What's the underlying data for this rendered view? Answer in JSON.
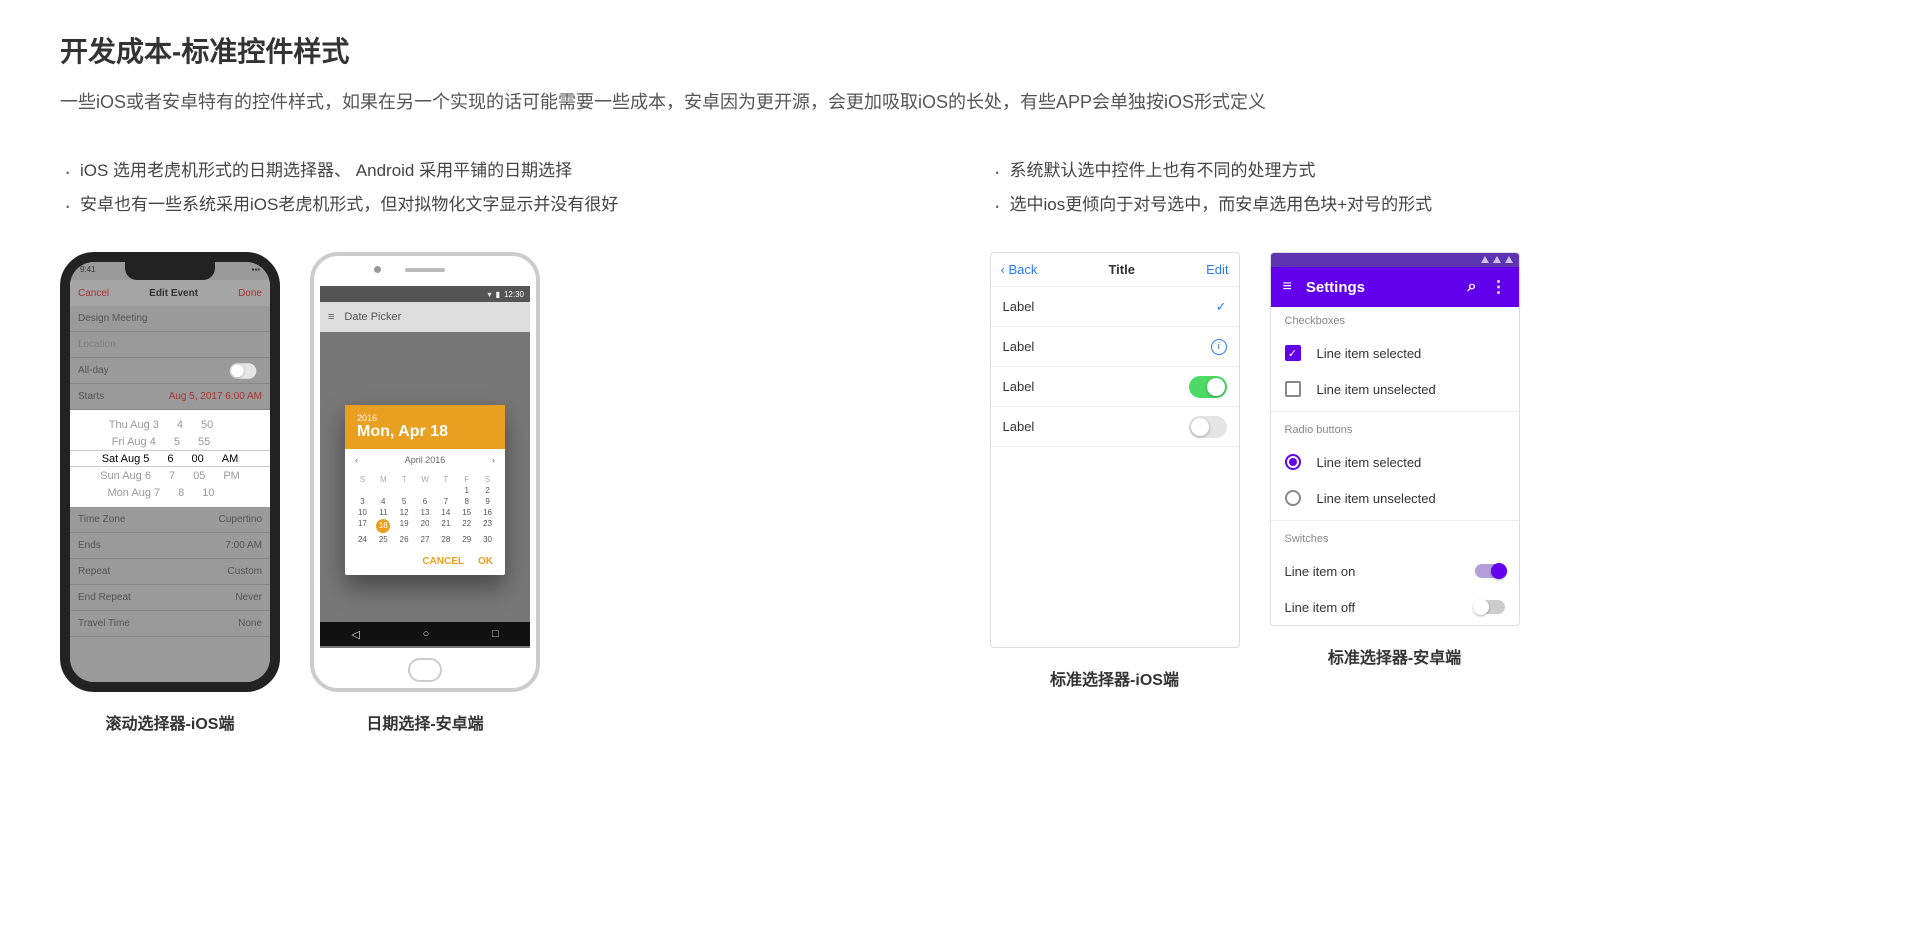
{
  "title": "开发成本-标准控件样式",
  "subtitle": "一些iOS或者安卓特有的控件样式，如果在另一个实现的话可能需要一些成本，安卓因为更开源，会更加吸取iOS的长处，有些APP会单独按iOS形式定义",
  "left_bullets": [
    "iOS 选用老虎机形式的日期选择器、 Android 采用平铺的日期选择",
    "安卓也有一些系统采用iOS老虎机形式，但对拟物化文字显示并没有很好"
  ],
  "right_bullets": [
    "系统默认选中控件上也有不同的处理方式",
    "选中ios更倾向于对号选中，而安卓选用色块+对号的形式"
  ],
  "captions": {
    "ios_picker": "滚动选择器-iOS端",
    "android_picker": "日期选择-安卓端",
    "ios_list": "标准选择器-iOS端",
    "android_list": "标准选择器-安卓端"
  },
  "ios_picker": {
    "status_time": "9:41",
    "cancel": "Cancel",
    "title": "Edit Event",
    "done": "Done",
    "row1": "Design Meeting",
    "row2_label": "All-day",
    "row3_l": "Starts",
    "row3_r": "Aug 5, 2017   6:00 AM",
    "wheel": [
      {
        "d": "Thu Aug 3",
        "h": "4",
        "m": "50",
        "ap": ""
      },
      {
        "d": "Fri Aug 4",
        "h": "5",
        "m": "55",
        "ap": ""
      },
      {
        "d": "Sat Aug 5",
        "h": "6",
        "m": "00",
        "ap": "AM"
      },
      {
        "d": "Sun Aug 6",
        "h": "7",
        "m": "05",
        "ap": "PM"
      },
      {
        "d": "Mon Aug 7",
        "h": "8",
        "m": "10",
        "ap": ""
      }
    ],
    "rows_after": [
      {
        "l": "Time Zone",
        "r": "Cupertino"
      },
      {
        "l": "Ends",
        "r": "7:00 AM"
      },
      {
        "l": "Repeat",
        "r": "Custom"
      },
      {
        "l": "End Repeat",
        "r": "Never"
      },
      {
        "l": "Travel Time",
        "r": "None"
      }
    ]
  },
  "android_picker": {
    "status_time": "12:30",
    "appbar": "Date Picker",
    "year": "2016",
    "headline": "Mon, Apr 18",
    "month": "April 2016",
    "dow": [
      "S",
      "M",
      "T",
      "W",
      "T",
      "F",
      "S"
    ],
    "days": [
      "",
      "",
      "",
      "",
      "",
      "1",
      "2",
      "3",
      "4",
      "5",
      "6",
      "7",
      "8",
      "9",
      "10",
      "11",
      "12",
      "13",
      "14",
      "15",
      "16",
      "17",
      "18",
      "19",
      "20",
      "21",
      "22",
      "23",
      "24",
      "25",
      "26",
      "27",
      "28",
      "29",
      "30"
    ],
    "selected_day": "18",
    "cancel": "CANCEL",
    "ok": "OK"
  },
  "ios_list": {
    "back": "Back",
    "title": "Title",
    "edit": "Edit",
    "items": [
      "Label",
      "Label",
      "Label",
      "Label"
    ]
  },
  "mat": {
    "appbar": "Settings",
    "sec1": "Checkboxes",
    "cb1": "Line item selected",
    "cb2": "Line item unselected",
    "sec2": "Radio buttons",
    "rb1": "Line item selected",
    "rb2": "Line item unselected",
    "sec3": "Switches",
    "sw1": "Line item on",
    "sw2": "Line item off"
  }
}
